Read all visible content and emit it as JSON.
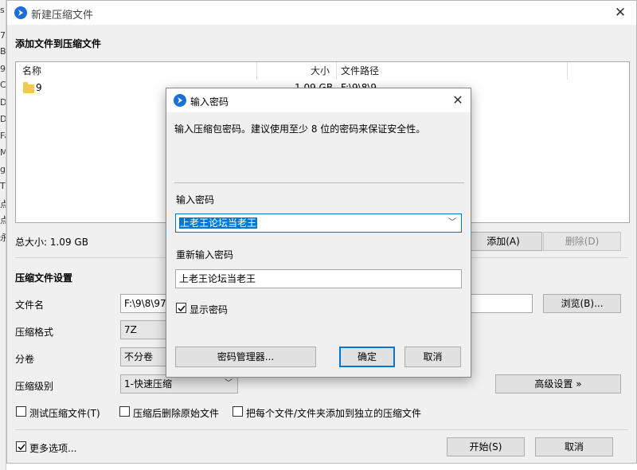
{
  "left_strip_chars": [
    "s",
    "7",
    "B",
    "9",
    "C",
    "D",
    "D",
    "Fa",
    "M",
    "g",
    "Tl",
    "点",
    "点",
    "永"
  ],
  "main_window": {
    "title": "新建压缩文件",
    "section_add": "添加文件到压缩文件",
    "columns": {
      "name": "名称",
      "size": "大小",
      "path": "文件路径"
    },
    "file_row": {
      "name": "9",
      "size": "1.09 GB",
      "path": "F:\\9\\8\\9"
    },
    "total_size": "总大小: 1.09 GB",
    "add_button": "添加(A)",
    "delete_button": "删除(D)",
    "section_settings": "压缩文件设置",
    "filename_label": "文件名",
    "filename_value": "F:\\9\\8\\97(",
    "browse_button": "浏览(B)...",
    "format_label": "压缩格式",
    "format_value": "7Z",
    "split_label": "分卷",
    "split_value": "不分卷",
    "level_label": "压缩级别",
    "level_value": "1-快速压缩",
    "advanced_button": "高级设置 »",
    "check_test": "测试压缩文件(T)",
    "check_delete": "压缩后删除原始文件",
    "check_each": "把每个文件/文件夹添加到独立的压缩文件",
    "more_options": "更多选项...",
    "start_button": "开始(S)",
    "cancel_button": "取消"
  },
  "password_dialog": {
    "title": "输入密码",
    "description": "输入压缩包密码。建议使用至少 8 位的密码来保证安全性。",
    "password_label": "输入密码",
    "password_value": "上老王论坛当老王",
    "reenter_label": "重新输入密码",
    "reenter_value": "上老王论坛当老王",
    "show_password": "显示密码",
    "show_password_checked": true,
    "manager_button": "密码管理器...",
    "ok_button": "确定",
    "cancel_button": "取消"
  },
  "colors": {
    "accent": "#0078d7",
    "app_icon": "#1a6fd8",
    "folder": "#f3c94b"
  }
}
